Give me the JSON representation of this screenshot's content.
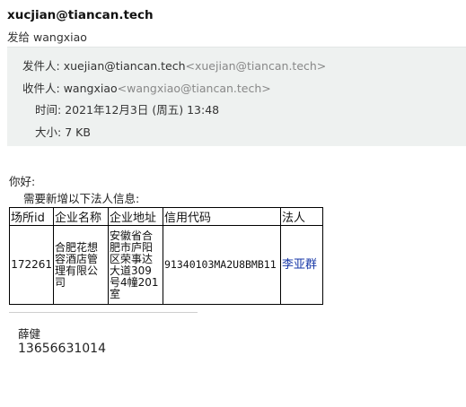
{
  "header": {
    "sender": "xucjian@tiancan.tech",
    "sent_to_label": "发给",
    "sent_to": "wangxiao"
  },
  "meta": {
    "from_label": "发件人:",
    "from_name": "xuejian@tiancan.tech",
    "from_addr": "<xuejian@tiancan.tech>",
    "to_label": "收件人:",
    "to_name": "wangxiao",
    "to_addr": "<wangxiao@tiancan.tech>",
    "time_label": "时间:",
    "time_value": "2021年12月3日 (周五) 13:48",
    "size_label": "大小:",
    "size_value": "7 KB"
  },
  "body": {
    "greeting": "你好:",
    "intro": "需要新增以下法人信息:"
  },
  "table": {
    "headers": [
      "场所id",
      "企业名称",
      "企业地址",
      "信用代码",
      "法人"
    ],
    "rows": [
      {
        "id": "172261",
        "name": "合肥花想容酒店管理有限公司",
        "address": "安徽省合肥市庐阳区荣事达大道309号4幢201室",
        "code": "91340103MA2U8BMB11",
        "legal": "李亚群"
      }
    ]
  },
  "signature": {
    "name": "薛健",
    "phone": "13656631014"
  }
}
